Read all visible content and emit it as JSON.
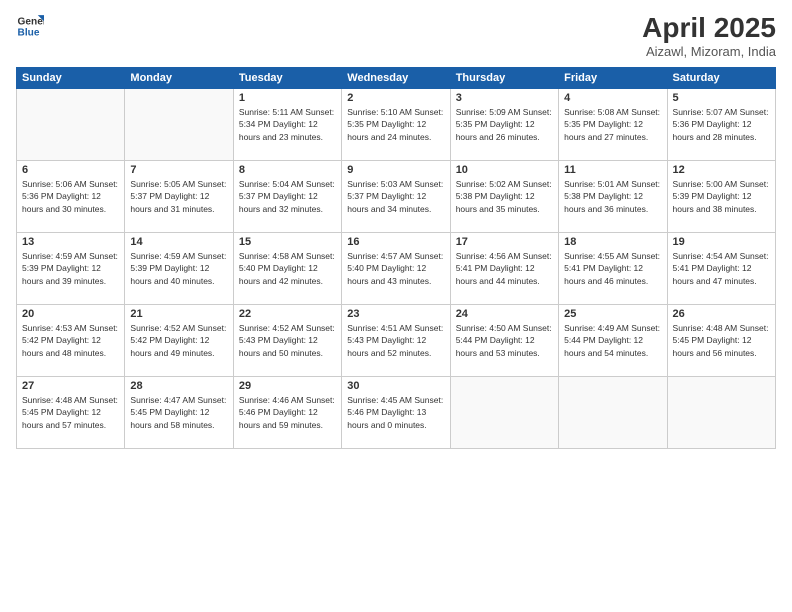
{
  "header": {
    "logo_general": "General",
    "logo_blue": "Blue",
    "title": "April 2025",
    "location": "Aizawl, Mizoram, India"
  },
  "calendar": {
    "days_of_week": [
      "Sunday",
      "Monday",
      "Tuesday",
      "Wednesday",
      "Thursday",
      "Friday",
      "Saturday"
    ],
    "weeks": [
      [
        {
          "day": "",
          "info": ""
        },
        {
          "day": "",
          "info": ""
        },
        {
          "day": "1",
          "info": "Sunrise: 5:11 AM\nSunset: 5:34 PM\nDaylight: 12 hours\nand 23 minutes."
        },
        {
          "day": "2",
          "info": "Sunrise: 5:10 AM\nSunset: 5:35 PM\nDaylight: 12 hours\nand 24 minutes."
        },
        {
          "day": "3",
          "info": "Sunrise: 5:09 AM\nSunset: 5:35 PM\nDaylight: 12 hours\nand 26 minutes."
        },
        {
          "day": "4",
          "info": "Sunrise: 5:08 AM\nSunset: 5:35 PM\nDaylight: 12 hours\nand 27 minutes."
        },
        {
          "day": "5",
          "info": "Sunrise: 5:07 AM\nSunset: 5:36 PM\nDaylight: 12 hours\nand 28 minutes."
        }
      ],
      [
        {
          "day": "6",
          "info": "Sunrise: 5:06 AM\nSunset: 5:36 PM\nDaylight: 12 hours\nand 30 minutes."
        },
        {
          "day": "7",
          "info": "Sunrise: 5:05 AM\nSunset: 5:37 PM\nDaylight: 12 hours\nand 31 minutes."
        },
        {
          "day": "8",
          "info": "Sunrise: 5:04 AM\nSunset: 5:37 PM\nDaylight: 12 hours\nand 32 minutes."
        },
        {
          "day": "9",
          "info": "Sunrise: 5:03 AM\nSunset: 5:37 PM\nDaylight: 12 hours\nand 34 minutes."
        },
        {
          "day": "10",
          "info": "Sunrise: 5:02 AM\nSunset: 5:38 PM\nDaylight: 12 hours\nand 35 minutes."
        },
        {
          "day": "11",
          "info": "Sunrise: 5:01 AM\nSunset: 5:38 PM\nDaylight: 12 hours\nand 36 minutes."
        },
        {
          "day": "12",
          "info": "Sunrise: 5:00 AM\nSunset: 5:39 PM\nDaylight: 12 hours\nand 38 minutes."
        }
      ],
      [
        {
          "day": "13",
          "info": "Sunrise: 4:59 AM\nSunset: 5:39 PM\nDaylight: 12 hours\nand 39 minutes."
        },
        {
          "day": "14",
          "info": "Sunrise: 4:59 AM\nSunset: 5:39 PM\nDaylight: 12 hours\nand 40 minutes."
        },
        {
          "day": "15",
          "info": "Sunrise: 4:58 AM\nSunset: 5:40 PM\nDaylight: 12 hours\nand 42 minutes."
        },
        {
          "day": "16",
          "info": "Sunrise: 4:57 AM\nSunset: 5:40 PM\nDaylight: 12 hours\nand 43 minutes."
        },
        {
          "day": "17",
          "info": "Sunrise: 4:56 AM\nSunset: 5:41 PM\nDaylight: 12 hours\nand 44 minutes."
        },
        {
          "day": "18",
          "info": "Sunrise: 4:55 AM\nSunset: 5:41 PM\nDaylight: 12 hours\nand 46 minutes."
        },
        {
          "day": "19",
          "info": "Sunrise: 4:54 AM\nSunset: 5:41 PM\nDaylight: 12 hours\nand 47 minutes."
        }
      ],
      [
        {
          "day": "20",
          "info": "Sunrise: 4:53 AM\nSunset: 5:42 PM\nDaylight: 12 hours\nand 48 minutes."
        },
        {
          "day": "21",
          "info": "Sunrise: 4:52 AM\nSunset: 5:42 PM\nDaylight: 12 hours\nand 49 minutes."
        },
        {
          "day": "22",
          "info": "Sunrise: 4:52 AM\nSunset: 5:43 PM\nDaylight: 12 hours\nand 50 minutes."
        },
        {
          "day": "23",
          "info": "Sunrise: 4:51 AM\nSunset: 5:43 PM\nDaylight: 12 hours\nand 52 minutes."
        },
        {
          "day": "24",
          "info": "Sunrise: 4:50 AM\nSunset: 5:44 PM\nDaylight: 12 hours\nand 53 minutes."
        },
        {
          "day": "25",
          "info": "Sunrise: 4:49 AM\nSunset: 5:44 PM\nDaylight: 12 hours\nand 54 minutes."
        },
        {
          "day": "26",
          "info": "Sunrise: 4:48 AM\nSunset: 5:45 PM\nDaylight: 12 hours\nand 56 minutes."
        }
      ],
      [
        {
          "day": "27",
          "info": "Sunrise: 4:48 AM\nSunset: 5:45 PM\nDaylight: 12 hours\nand 57 minutes."
        },
        {
          "day": "28",
          "info": "Sunrise: 4:47 AM\nSunset: 5:45 PM\nDaylight: 12 hours\nand 58 minutes."
        },
        {
          "day": "29",
          "info": "Sunrise: 4:46 AM\nSunset: 5:46 PM\nDaylight: 12 hours\nand 59 minutes."
        },
        {
          "day": "30",
          "info": "Sunrise: 4:45 AM\nSunset: 5:46 PM\nDaylight: 13 hours\nand 0 minutes."
        },
        {
          "day": "",
          "info": ""
        },
        {
          "day": "",
          "info": ""
        },
        {
          "day": "",
          "info": ""
        }
      ]
    ]
  }
}
